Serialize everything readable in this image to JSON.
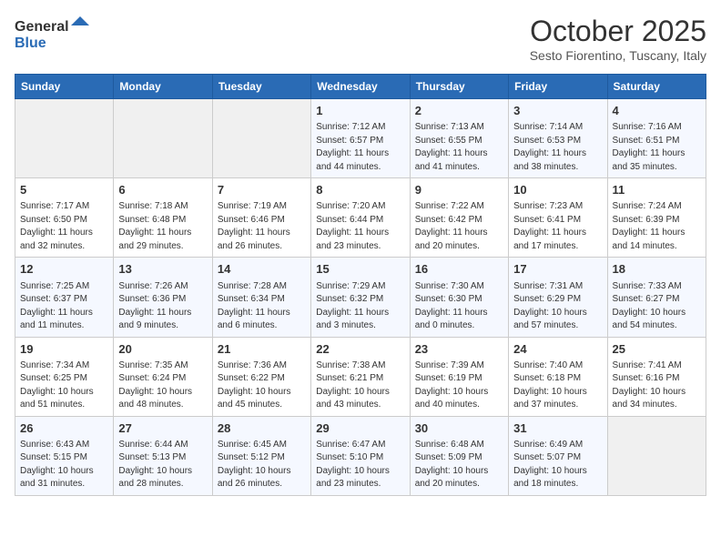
{
  "header": {
    "logo_line1": "General",
    "logo_line2": "Blue",
    "month": "October 2025",
    "location": "Sesto Fiorentino, Tuscany, Italy"
  },
  "days_of_week": [
    "Sunday",
    "Monday",
    "Tuesday",
    "Wednesday",
    "Thursday",
    "Friday",
    "Saturday"
  ],
  "weeks": [
    [
      {
        "day": "",
        "info": ""
      },
      {
        "day": "",
        "info": ""
      },
      {
        "day": "",
        "info": ""
      },
      {
        "day": "1",
        "info": "Sunrise: 7:12 AM\nSunset: 6:57 PM\nDaylight: 11 hours and 44 minutes."
      },
      {
        "day": "2",
        "info": "Sunrise: 7:13 AM\nSunset: 6:55 PM\nDaylight: 11 hours and 41 minutes."
      },
      {
        "day": "3",
        "info": "Sunrise: 7:14 AM\nSunset: 6:53 PM\nDaylight: 11 hours and 38 minutes."
      },
      {
        "day": "4",
        "info": "Sunrise: 7:16 AM\nSunset: 6:51 PM\nDaylight: 11 hours and 35 minutes."
      }
    ],
    [
      {
        "day": "5",
        "info": "Sunrise: 7:17 AM\nSunset: 6:50 PM\nDaylight: 11 hours and 32 minutes."
      },
      {
        "day": "6",
        "info": "Sunrise: 7:18 AM\nSunset: 6:48 PM\nDaylight: 11 hours and 29 minutes."
      },
      {
        "day": "7",
        "info": "Sunrise: 7:19 AM\nSunset: 6:46 PM\nDaylight: 11 hours and 26 minutes."
      },
      {
        "day": "8",
        "info": "Sunrise: 7:20 AM\nSunset: 6:44 PM\nDaylight: 11 hours and 23 minutes."
      },
      {
        "day": "9",
        "info": "Sunrise: 7:22 AM\nSunset: 6:42 PM\nDaylight: 11 hours and 20 minutes."
      },
      {
        "day": "10",
        "info": "Sunrise: 7:23 AM\nSunset: 6:41 PM\nDaylight: 11 hours and 17 minutes."
      },
      {
        "day": "11",
        "info": "Sunrise: 7:24 AM\nSunset: 6:39 PM\nDaylight: 11 hours and 14 minutes."
      }
    ],
    [
      {
        "day": "12",
        "info": "Sunrise: 7:25 AM\nSunset: 6:37 PM\nDaylight: 11 hours and 11 minutes."
      },
      {
        "day": "13",
        "info": "Sunrise: 7:26 AM\nSunset: 6:36 PM\nDaylight: 11 hours and 9 minutes."
      },
      {
        "day": "14",
        "info": "Sunrise: 7:28 AM\nSunset: 6:34 PM\nDaylight: 11 hours and 6 minutes."
      },
      {
        "day": "15",
        "info": "Sunrise: 7:29 AM\nSunset: 6:32 PM\nDaylight: 11 hours and 3 minutes."
      },
      {
        "day": "16",
        "info": "Sunrise: 7:30 AM\nSunset: 6:30 PM\nDaylight: 11 hours and 0 minutes."
      },
      {
        "day": "17",
        "info": "Sunrise: 7:31 AM\nSunset: 6:29 PM\nDaylight: 10 hours and 57 minutes."
      },
      {
        "day": "18",
        "info": "Sunrise: 7:33 AM\nSunset: 6:27 PM\nDaylight: 10 hours and 54 minutes."
      }
    ],
    [
      {
        "day": "19",
        "info": "Sunrise: 7:34 AM\nSunset: 6:25 PM\nDaylight: 10 hours and 51 minutes."
      },
      {
        "day": "20",
        "info": "Sunrise: 7:35 AM\nSunset: 6:24 PM\nDaylight: 10 hours and 48 minutes."
      },
      {
        "day": "21",
        "info": "Sunrise: 7:36 AM\nSunset: 6:22 PM\nDaylight: 10 hours and 45 minutes."
      },
      {
        "day": "22",
        "info": "Sunrise: 7:38 AM\nSunset: 6:21 PM\nDaylight: 10 hours and 43 minutes."
      },
      {
        "day": "23",
        "info": "Sunrise: 7:39 AM\nSunset: 6:19 PM\nDaylight: 10 hours and 40 minutes."
      },
      {
        "day": "24",
        "info": "Sunrise: 7:40 AM\nSunset: 6:18 PM\nDaylight: 10 hours and 37 minutes."
      },
      {
        "day": "25",
        "info": "Sunrise: 7:41 AM\nSunset: 6:16 PM\nDaylight: 10 hours and 34 minutes."
      }
    ],
    [
      {
        "day": "26",
        "info": "Sunrise: 6:43 AM\nSunset: 5:15 PM\nDaylight: 10 hours and 31 minutes."
      },
      {
        "day": "27",
        "info": "Sunrise: 6:44 AM\nSunset: 5:13 PM\nDaylight: 10 hours and 28 minutes."
      },
      {
        "day": "28",
        "info": "Sunrise: 6:45 AM\nSunset: 5:12 PM\nDaylight: 10 hours and 26 minutes."
      },
      {
        "day": "29",
        "info": "Sunrise: 6:47 AM\nSunset: 5:10 PM\nDaylight: 10 hours and 23 minutes."
      },
      {
        "day": "30",
        "info": "Sunrise: 6:48 AM\nSunset: 5:09 PM\nDaylight: 10 hours and 20 minutes."
      },
      {
        "day": "31",
        "info": "Sunrise: 6:49 AM\nSunset: 5:07 PM\nDaylight: 10 hours and 18 minutes."
      },
      {
        "day": "",
        "info": ""
      }
    ]
  ]
}
